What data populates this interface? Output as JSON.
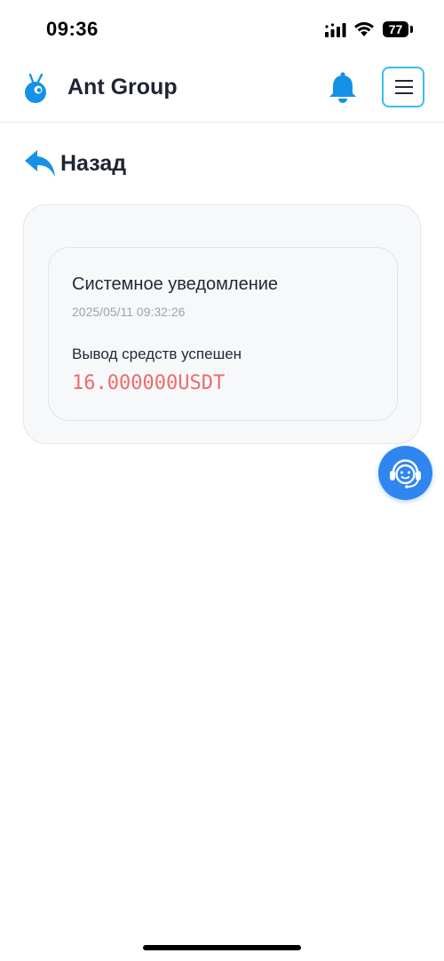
{
  "status_bar": {
    "time": "09:36",
    "battery": "77"
  },
  "header": {
    "title": "Ant Group",
    "accent_color": "#1592e6"
  },
  "back": {
    "label": "Назад"
  },
  "notification": {
    "title": "Системное уведомление",
    "timestamp": "2025/05/11 09:32:26",
    "message": "Вывод средств успешен",
    "amount": "16.000000USDT",
    "amount_color": "#f06a6a"
  },
  "icons": {
    "logo": "ant-logo-icon",
    "bell": "bell-icon",
    "menu": "hamburger-menu-icon",
    "back": "back-arrow-icon",
    "support": "customer-support-icon"
  }
}
